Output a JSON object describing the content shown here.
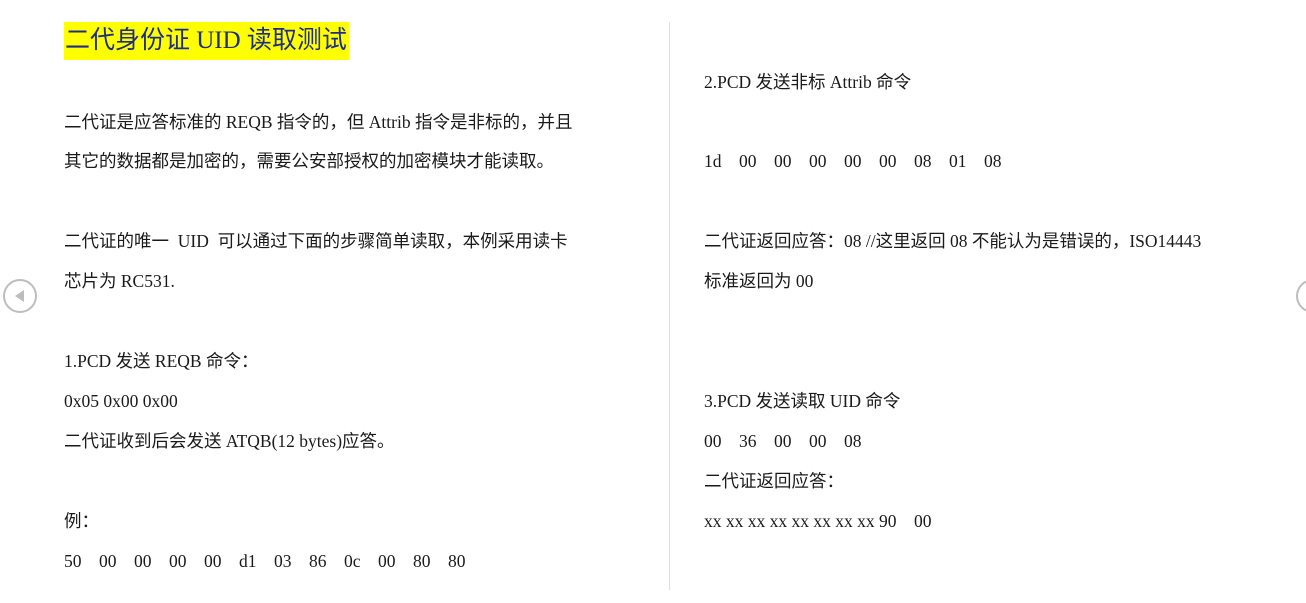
{
  "left": {
    "title": "二代身份证 UID 读取测试",
    "lines": [
      "二代证是应答标准的 REQB 指令的，但 Attrib 指令是非标的，并且",
      "其它的数据都是加密的，需要公安部授权的加密模块才能读取。",
      "二代证的唯一  UID  可以通过下面的步骤简单读取，本例采用读卡",
      "芯片为 RC531.",
      "1.PCD 发送 REQB 命令：",
      "0x05 0x00 0x00",
      "二代证收到后会发送 ATQB(12 bytes)应答。",
      "例：",
      "50    00    00    00    00    d1    03    86    0c    00    80    80"
    ]
  },
  "right": {
    "lines": [
      "2.PCD 发送非标 Attrib 命令",
      "1d    00    00    00    00    00    08    01    08",
      "二代证返回应答：08 //这里返回 08 不能认为是错误的，ISO14443",
      "标准返回为 00",
      "3.PCD 发送读取 UID 命令",
      "00    36    00    00    08",
      "二代证返回应答：",
      "xx xx xx xx xx xx xx xx 90    00"
    ]
  },
  "nav": {
    "prev_icon": "prev-page-arrow-icon",
    "next_icon": "next-page-arrow-icon"
  },
  "colors": {
    "highlight": "#ffff00",
    "title_text": "#1f2d8a",
    "body_text": "#1a1a1a",
    "divider": "#dedede"
  }
}
